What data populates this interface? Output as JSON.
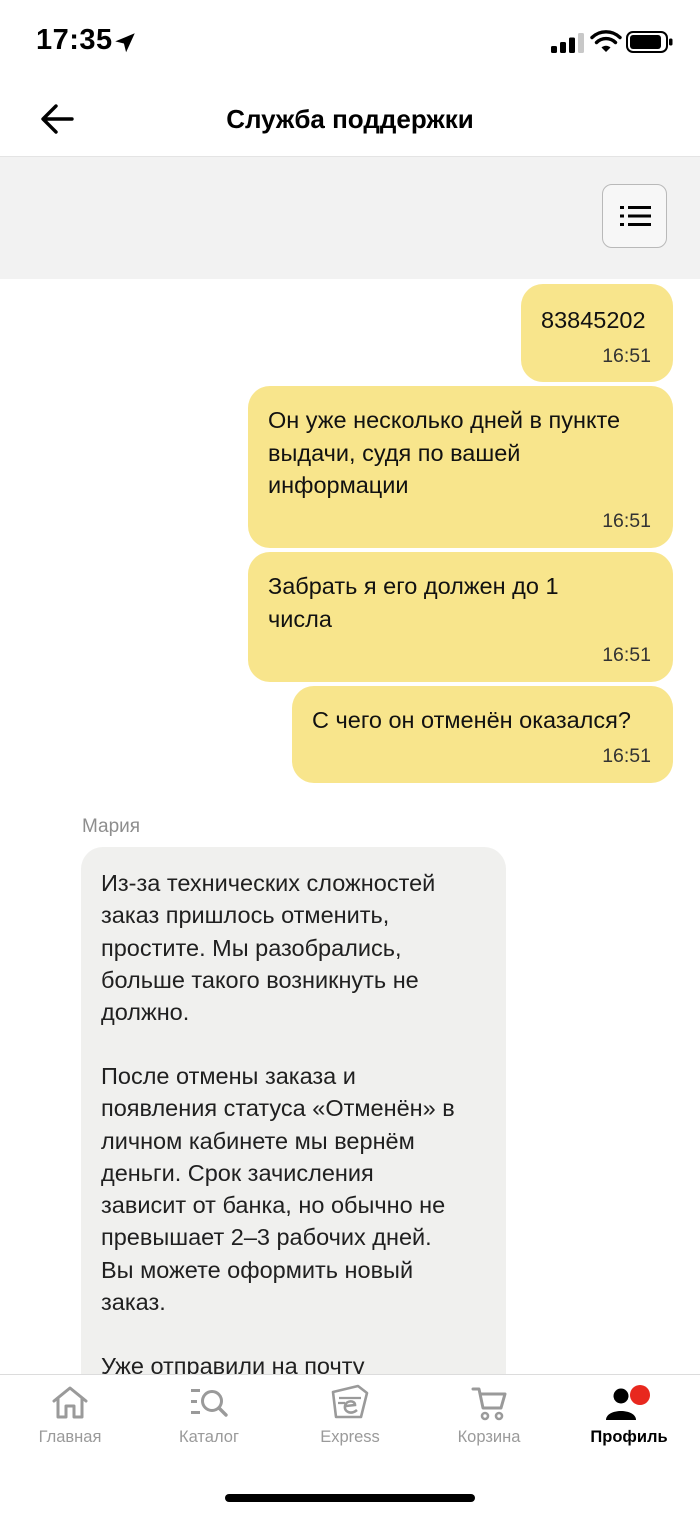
{
  "status_bar": {
    "time": "17:35"
  },
  "header": {
    "title": "Служба поддержки"
  },
  "messages_out": [
    {
      "lines": [
        "83845202"
      ],
      "time": "16:51"
    },
    {
      "lines": [
        "Он уже несколько дней в пункте",
        "выдачи, судя по вашей",
        "информации"
      ],
      "time": "16:51"
    },
    {
      "lines": [
        "Забрать я его должен до 1",
        "числа"
      ],
      "time": "16:51"
    },
    {
      "lines": [
        "С чего он отменён оказался?"
      ],
      "time": "16:51"
    }
  ],
  "message_in": {
    "sender": "Мария",
    "paragraphs": [
      [
        "Из-за технических сложностей",
        "заказ пришлось отменить,",
        "простите. Мы разобрались,",
        "больше такого возникнуть не",
        "должно."
      ],
      [
        "После отмены заказа и",
        "появления статуса «Отменён» в",
        "личном кабинете мы вернём",
        "деньги. Срок зачисления",
        "зависит от банка, но обычно не",
        "превышает 2–3 рабочих дней.",
        "Вы можете оформить новый",
        "заказ."
      ],
      [
        "Уже отправили на почту"
      ]
    ]
  },
  "tabs": [
    {
      "label": "Главная",
      "icon": "home-icon",
      "active": false
    },
    {
      "label": "Каталог",
      "icon": "catalog-search-icon",
      "active": false
    },
    {
      "label": "Express",
      "icon": "express-icon",
      "active": false
    },
    {
      "label": "Корзина",
      "icon": "cart-icon",
      "active": false
    },
    {
      "label": "Профиль",
      "icon": "profile-icon",
      "active": true
    }
  ],
  "colors": {
    "outgoing_bubble": "#f8e58c",
    "incoming_bubble": "#f0f0ee",
    "notification_dot": "#e8281e"
  }
}
